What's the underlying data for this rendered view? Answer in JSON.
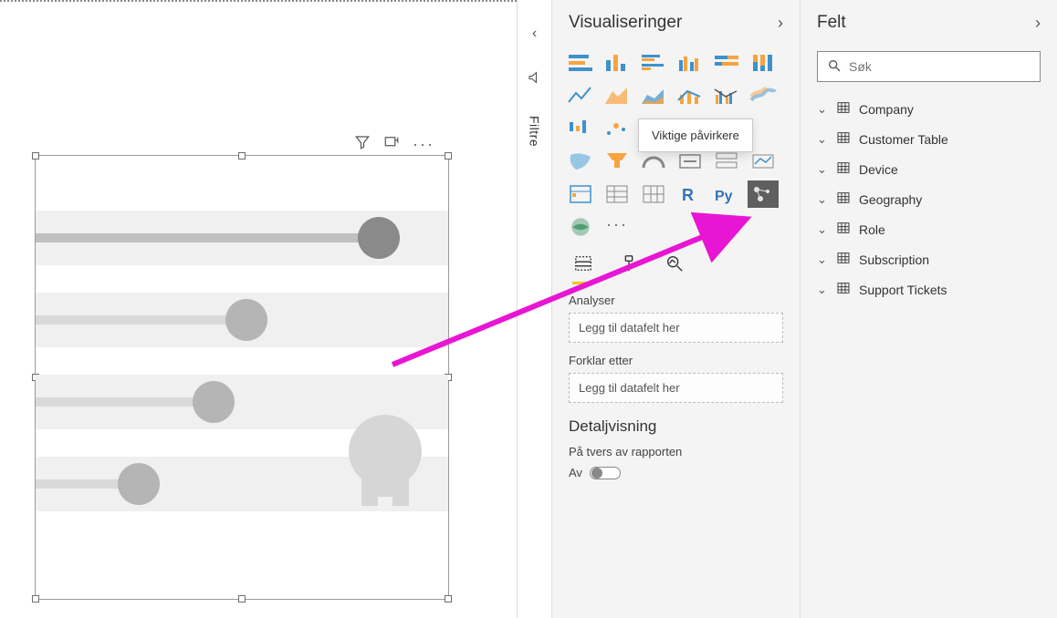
{
  "filters_pane": {
    "label": "Filtre"
  },
  "visualizations_pane": {
    "title": "Visualiseringer",
    "tooltip": "Viktige påvirkere"
  },
  "fieldwells": {
    "analyze": {
      "label": "Analyser",
      "placeholder": "Legg til datafelt her"
    },
    "explain_by": {
      "label": "Forklar etter",
      "placeholder": "Legg til datafelt her"
    }
  },
  "drillthrough": {
    "title": "Detaljvisning",
    "cross_report_label": "På tvers av rapporten",
    "toggle_off": "Av"
  },
  "fields_pane": {
    "title": "Felt",
    "search_placeholder": "Søk",
    "tables": [
      {
        "name": "Company"
      },
      {
        "name": "Customer Table"
      },
      {
        "name": "Device"
      },
      {
        "name": "Geography"
      },
      {
        "name": "Role"
      },
      {
        "name": "Subscription"
      },
      {
        "name": "Support Tickets"
      }
    ]
  }
}
